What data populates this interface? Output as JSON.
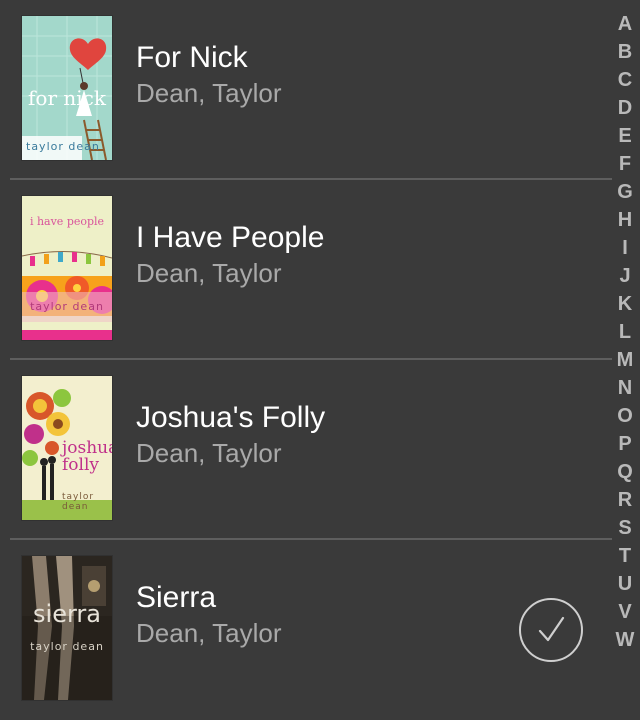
{
  "books": [
    {
      "title": "For Nick",
      "author": "Dean, Taylor",
      "cover_title": "for nick",
      "cover_author": "taylor dean",
      "cover_colors": {
        "bg": "#9fd6c8",
        "accent": "#e0453e"
      },
      "selected": false
    },
    {
      "title": "I Have People",
      "author": "Dean, Taylor",
      "cover_title": "i have people",
      "cover_author": "taylor dean",
      "cover_colors": {
        "bg": "#eef0c8",
        "accent": "#e8308c"
      },
      "selected": false
    },
    {
      "title": "Joshua's Folly",
      "author": "Dean, Taylor",
      "cover_title": "joshua's folly",
      "cover_author": "taylor dean",
      "cover_colors": {
        "bg": "#f3efcf",
        "accent": "#c8732a"
      },
      "selected": false
    },
    {
      "title": "Sierra",
      "author": "Dean, Taylor",
      "cover_title": "sierra",
      "cover_author": "taylor dean",
      "cover_colors": {
        "bg": "#2b2620",
        "accent": "#e7e2d8"
      },
      "selected": true
    }
  ],
  "index_letters": [
    "A",
    "B",
    "C",
    "D",
    "E",
    "F",
    "G",
    "H",
    "I",
    "J",
    "K",
    "L",
    "M",
    "N",
    "O",
    "P",
    "Q",
    "R",
    "S",
    "T",
    "U",
    "V",
    "W"
  ],
  "icons": {
    "selection": "checkmark-circle-icon"
  },
  "colors": {
    "background": "#3a3a3a",
    "title": "#ffffff",
    "author": "#a9a9a9",
    "divider": "#5e5e5e",
    "index": "#b9b9b9"
  }
}
